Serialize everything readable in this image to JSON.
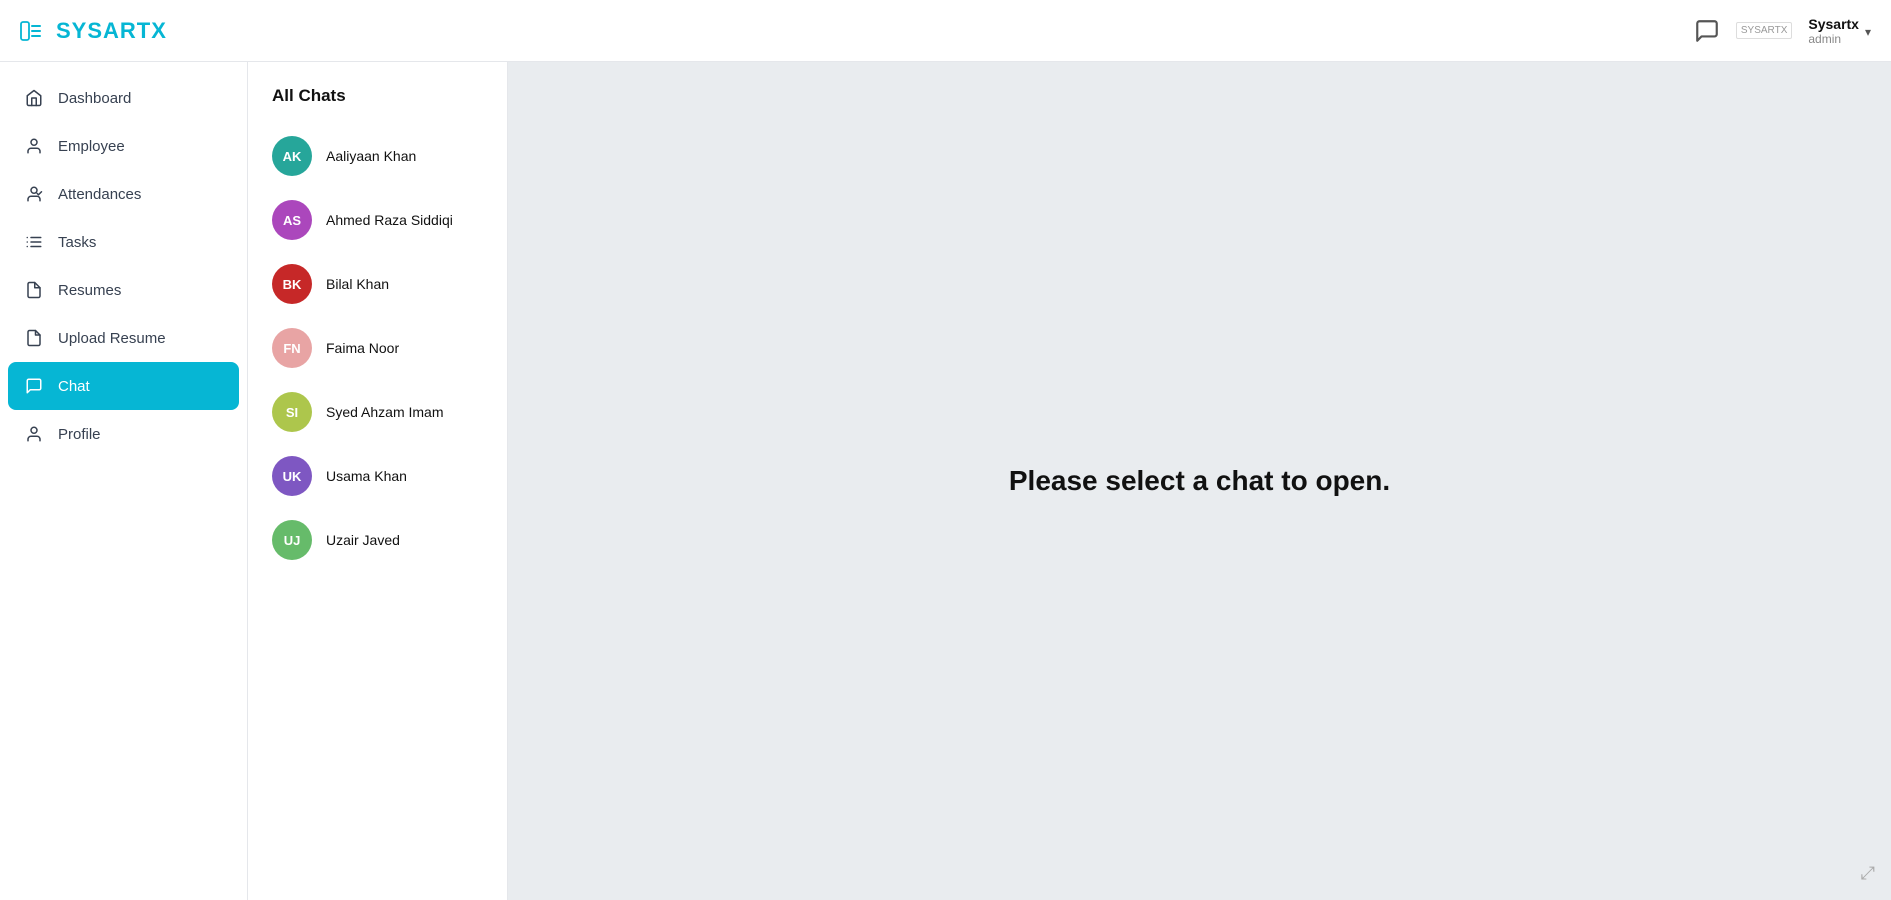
{
  "header": {
    "logo_prefix": "SYSART",
    "logo_suffix": "X",
    "chat_icon_label": "chat-bubble",
    "brand_small": "SYSARTX",
    "user_name": "Sysartx",
    "user_role": "admin"
  },
  "sidebar": {
    "items": [
      {
        "id": "dashboard",
        "label": "Dashboard",
        "icon": "home",
        "active": false
      },
      {
        "id": "employee",
        "label": "Employee",
        "icon": "person",
        "active": false
      },
      {
        "id": "attendances",
        "label": "Attendances",
        "icon": "person-check",
        "active": false
      },
      {
        "id": "tasks",
        "label": "Tasks",
        "icon": "list",
        "active": false
      },
      {
        "id": "resumes",
        "label": "Resumes",
        "icon": "file",
        "active": false
      },
      {
        "id": "upload-resume",
        "label": "Upload Resume",
        "icon": "file-upload",
        "active": false
      },
      {
        "id": "chat",
        "label": "Chat",
        "icon": "chat",
        "active": true
      },
      {
        "id": "profile",
        "label": "Profile",
        "icon": "person",
        "active": false
      }
    ]
  },
  "chat_panel": {
    "title": "All Chats",
    "contacts": [
      {
        "id": "ak",
        "initials": "AK",
        "name": "Aaliyaan Khan",
        "color": "#26a69a"
      },
      {
        "id": "as",
        "initials": "AS",
        "name": "Ahmed Raza Siddiqi",
        "color": "#ab47bc"
      },
      {
        "id": "bk",
        "initials": "BK",
        "name": "Bilal Khan",
        "color": "#c62828"
      },
      {
        "id": "fn",
        "initials": "FN",
        "name": "Faima Noor",
        "color": "#e8a4a4"
      },
      {
        "id": "si",
        "initials": "SI",
        "name": "Syed Ahzam Imam",
        "color": "#adc64c"
      },
      {
        "id": "uk",
        "initials": "UK",
        "name": "Usama Khan",
        "color": "#7e57c2"
      },
      {
        "id": "uj",
        "initials": "UJ",
        "name": "Uzair Javed",
        "color": "#66bb6a"
      }
    ]
  },
  "content": {
    "placeholder_message": "Please select a chat to open."
  }
}
